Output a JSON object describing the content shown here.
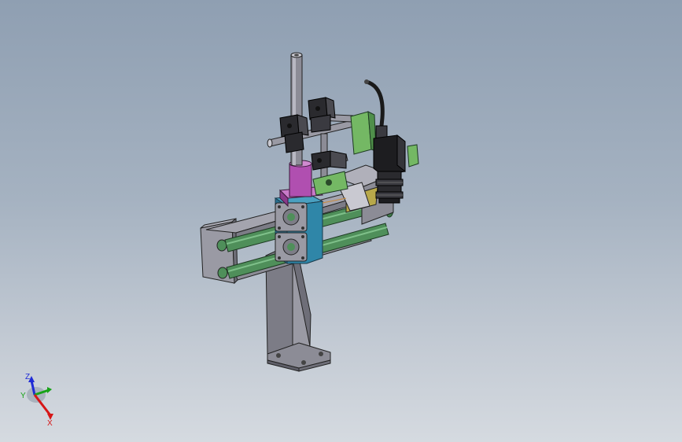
{
  "viewport": {
    "background_top": "#8f9fb2",
    "background_bottom": "#d5dae0"
  },
  "triad": {
    "z_label": "Z",
    "y_label": "Y",
    "x_label": "X",
    "z_color": "#1f2bd6",
    "y_color": "#17a317",
    "x_color": "#d61616"
  },
  "model": {
    "part_colors": {
      "frame_gray": "#8c8c96",
      "rod_green": "#4f8f5a",
      "block_blue": "#2f86a8",
      "sleeve_magenta": "#b04fb0",
      "bracket_green": "#74b864",
      "clamp_black": "#2a2a2e",
      "camera_black": "#1d1d20"
    }
  }
}
